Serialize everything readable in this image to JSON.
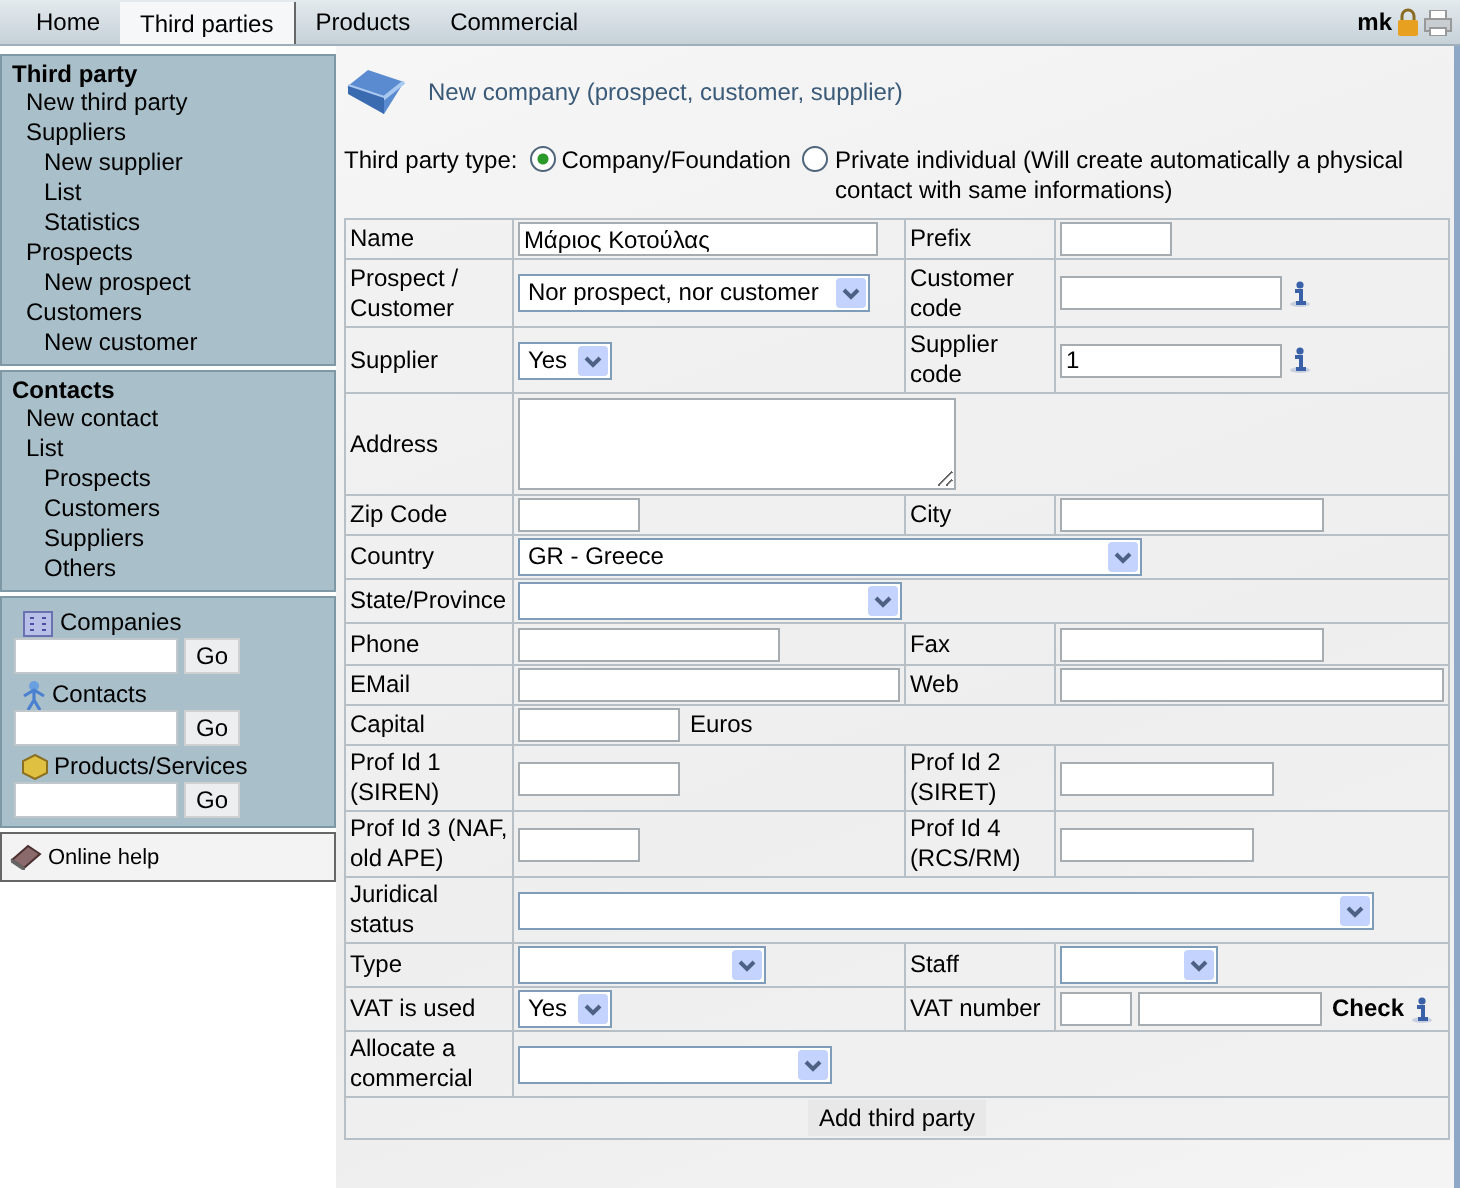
{
  "tabs": [
    {
      "label": "Home",
      "selected": false
    },
    {
      "label": "Third parties",
      "selected": true
    },
    {
      "label": "Products",
      "selected": false
    },
    {
      "label": "Commercial",
      "selected": false
    }
  ],
  "user": "mk",
  "sidebar": {
    "menus": [
      {
        "title": "Third party",
        "items": [
          {
            "label": "New third party"
          },
          {
            "label": "Suppliers",
            "children": [
              {
                "label": "New supplier"
              },
              {
                "label": "List"
              },
              {
                "label": "Statistics"
              }
            ]
          },
          {
            "label": "Prospects",
            "children": [
              {
                "label": "New prospect"
              }
            ]
          },
          {
            "label": "Customers",
            "children": [
              {
                "label": "New customer"
              }
            ]
          }
        ]
      },
      {
        "title": "Contacts",
        "items": [
          {
            "label": "New contact"
          },
          {
            "label": "List",
            "children": [
              {
                "label": "Prospects"
              },
              {
                "label": "Customers"
              },
              {
                "label": "Suppliers"
              },
              {
                "label": "Others"
              }
            ]
          }
        ]
      }
    ],
    "searches": [
      {
        "kind": "companies",
        "label": "Companies",
        "button": "Go"
      },
      {
        "kind": "contacts",
        "label": "Contacts",
        "button": "Go"
      },
      {
        "kind": "products",
        "label": "Products/Services",
        "button": "Go"
      }
    ],
    "help": "Online help"
  },
  "page_title": "New company (prospect, customer, supplier)",
  "type_label": "Third party type:",
  "type_options": [
    {
      "label": "Company/Foundation",
      "selected": true
    },
    {
      "label": "Private individual (Will create automatically a physical contact with same informations)",
      "selected": false
    }
  ],
  "rows": [
    {
      "cells": [
        {
          "label": "Name",
          "field": {
            "kind": "text",
            "value": "Μάριος Κοτούλας"
          }
        },
        {
          "label": "Prefix",
          "field": {
            "kind": "text"
          }
        }
      ]
    },
    {
      "cells": [
        {
          "label": "Prospect / Customer",
          "field": {
            "kind": "select",
            "value": "Nor prospect, nor customer"
          }
        },
        {
          "label": "Customer code",
          "field": {
            "kind": "text",
            "info": true
          }
        }
      ]
    },
    {
      "cells": [
        {
          "label": "Supplier",
          "field": {
            "kind": "select",
            "value": "Yes"
          }
        },
        {
          "label": "Supplier code",
          "field": {
            "kind": "text",
            "value": "1",
            "info": true
          }
        }
      ]
    },
    {
      "cells": [
        {
          "label": "Address",
          "field": {
            "kind": "textarea"
          }
        }
      ]
    },
    {
      "cells": [
        {
          "label": "Zip Code",
          "field": {
            "kind": "text"
          }
        },
        {
          "label": "City",
          "field": {
            "kind": "text"
          }
        }
      ]
    },
    {
      "cells": [
        {
          "label": "Country",
          "field": {
            "kind": "select",
            "value": "GR - Greece"
          }
        }
      ]
    },
    {
      "cells": [
        {
          "label": "State/Province",
          "field": {
            "kind": "select"
          }
        }
      ]
    },
    {
      "cells": [
        {
          "label": "Phone",
          "field": {
            "kind": "text"
          }
        },
        {
          "label": "Fax",
          "field": {
            "kind": "text"
          }
        }
      ]
    },
    {
      "cells": [
        {
          "label": "EMail",
          "field": {
            "kind": "text"
          }
        },
        {
          "label": "Web",
          "field": {
            "kind": "text"
          }
        }
      ]
    },
    {
      "cells": [
        {
          "label": "Capital",
          "field": {
            "kind": "text",
            "suffix": "Euros"
          }
        }
      ]
    },
    {
      "cells": [
        {
          "label": "Prof Id 1 (SIREN)",
          "field": {
            "kind": "text"
          }
        },
        {
          "label": "Prof Id 2 (SIRET)",
          "field": {
            "kind": "text"
          }
        }
      ]
    },
    {
      "cells": [
        {
          "label": "Prof Id 3 (NAF, old APE)",
          "field": {
            "kind": "text"
          }
        },
        {
          "label": "Prof Id 4 (RCS/RM)",
          "field": {
            "kind": "text"
          }
        }
      ]
    },
    {
      "cells": [
        {
          "label": "Juridical status",
          "field": {
            "kind": "select"
          }
        }
      ]
    },
    {
      "cells": [
        {
          "label": "Type",
          "field": {
            "kind": "select"
          }
        },
        {
          "label": "Staff",
          "field": {
            "kind": "select"
          }
        }
      ]
    },
    {
      "cells": [
        {
          "label": "VAT is used",
          "field": {
            "kind": "select",
            "value": "Yes"
          }
        },
        {
          "label": "VAT number",
          "field": {
            "kind": "vat",
            "link": "Check",
            "info": true
          }
        }
      ]
    },
    {
      "cells": [
        {
          "label": "Allocate a commercial",
          "field": {
            "kind": "select"
          }
        }
      ]
    }
  ],
  "submit": "Add third party"
}
